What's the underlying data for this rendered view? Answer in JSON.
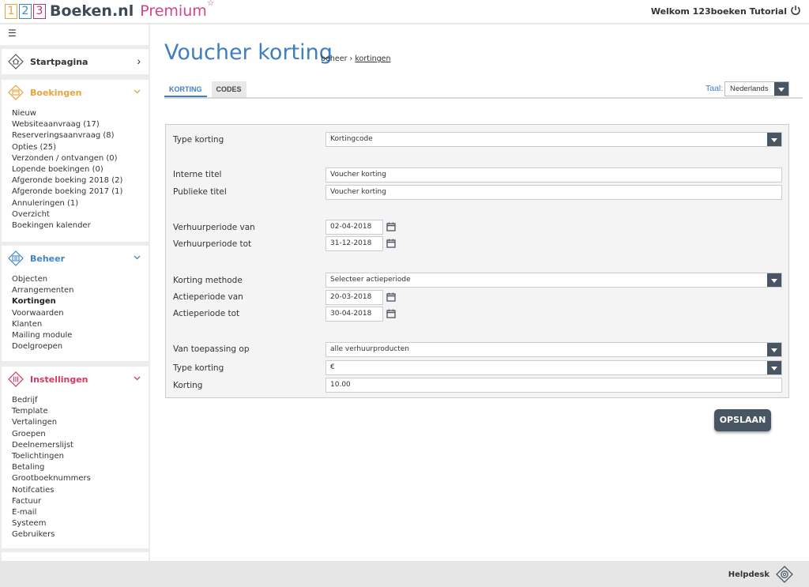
{
  "app": {
    "logo_digits": [
      "1",
      "2",
      "3"
    ],
    "brand": "Boeken.nl",
    "premium": "Premium",
    "premium_star": "☆",
    "welcome": "Welkom 123boeken Tutorial"
  },
  "sidebar": {
    "toggle_icon": "☰",
    "start": {
      "label": "Startpagina",
      "chevron": "›"
    },
    "boekingen": {
      "title": "Boekingen",
      "color": "#e8a33a",
      "items": [
        "Nieuw",
        "Websiteaanvraag (17)",
        "Reserveringsaanvraag (8)",
        "Opties (25)",
        "Verzonden / ontvangen (0)",
        "Lopende boekingen (0)",
        "Afgeronde boeking 2018 (2)",
        "Afgeronde boeking 2017 (1)",
        "Annuleringen (1)",
        "Overzicht",
        "Boekingen kalender"
      ]
    },
    "beheer": {
      "title": "Beheer",
      "color": "#3e86c9",
      "items": [
        "Objecten",
        "Arrangementen",
        "Kortingen",
        "Voorwaarden",
        "Klanten",
        "Mailing module",
        "Doelgroepen"
      ],
      "active": "Kortingen"
    },
    "instellingen": {
      "title": "Instellingen",
      "color": "#d6385f",
      "items": [
        "Bedrijf",
        "Template",
        "Vertalingen",
        "Groepen",
        "Deelnemerslijst",
        "Toelichtingen",
        "Betaling",
        "Grootboeknummers",
        "Notifcaties",
        "Factuur",
        "E-mail",
        "Systeem",
        "Gebruikers"
      ]
    }
  },
  "main": {
    "title": "Voucher korting",
    "breadcrumb": {
      "beheer": "beheer",
      "sep": "›",
      "kortingen": "kortingen"
    },
    "tabs": [
      "KORTING",
      "CODES"
    ],
    "taal_label": "Taal:",
    "taal_value": "Nederlands",
    "form": {
      "type_korting_label": "Type korting",
      "type_korting_value": "Kortingcode",
      "interne_titel_label": "Interne titel",
      "interne_titel_value": "Voucher korting",
      "publieke_titel_label": "Publieke titel",
      "publieke_titel_value": "Voucher korting",
      "verhuur_van_label": "Verhuurperiode van",
      "verhuur_van_value": "02-04-2018",
      "verhuur_tot_label": "Verhuurperiode tot",
      "verhuur_tot_value": "31-12-2018",
      "methode_label": "Korting methode",
      "methode_value": "Selecteer actieperiode",
      "actie_van_label": "Actieperiode van",
      "actie_van_value": "20-03-2018",
      "actie_tot_label": "Actieperiode tot",
      "actie_tot_value": "30-04-2018",
      "toepassing_label": "Van toepassing op",
      "toepassing_value": "alle verhuurproducten",
      "type2_label": "Type korting",
      "type2_value": "€",
      "korting_label": "Korting",
      "korting_value": "10.00"
    },
    "save_label": "OPSLAAN"
  },
  "footer": {
    "helpdesk": "Helpdesk"
  }
}
